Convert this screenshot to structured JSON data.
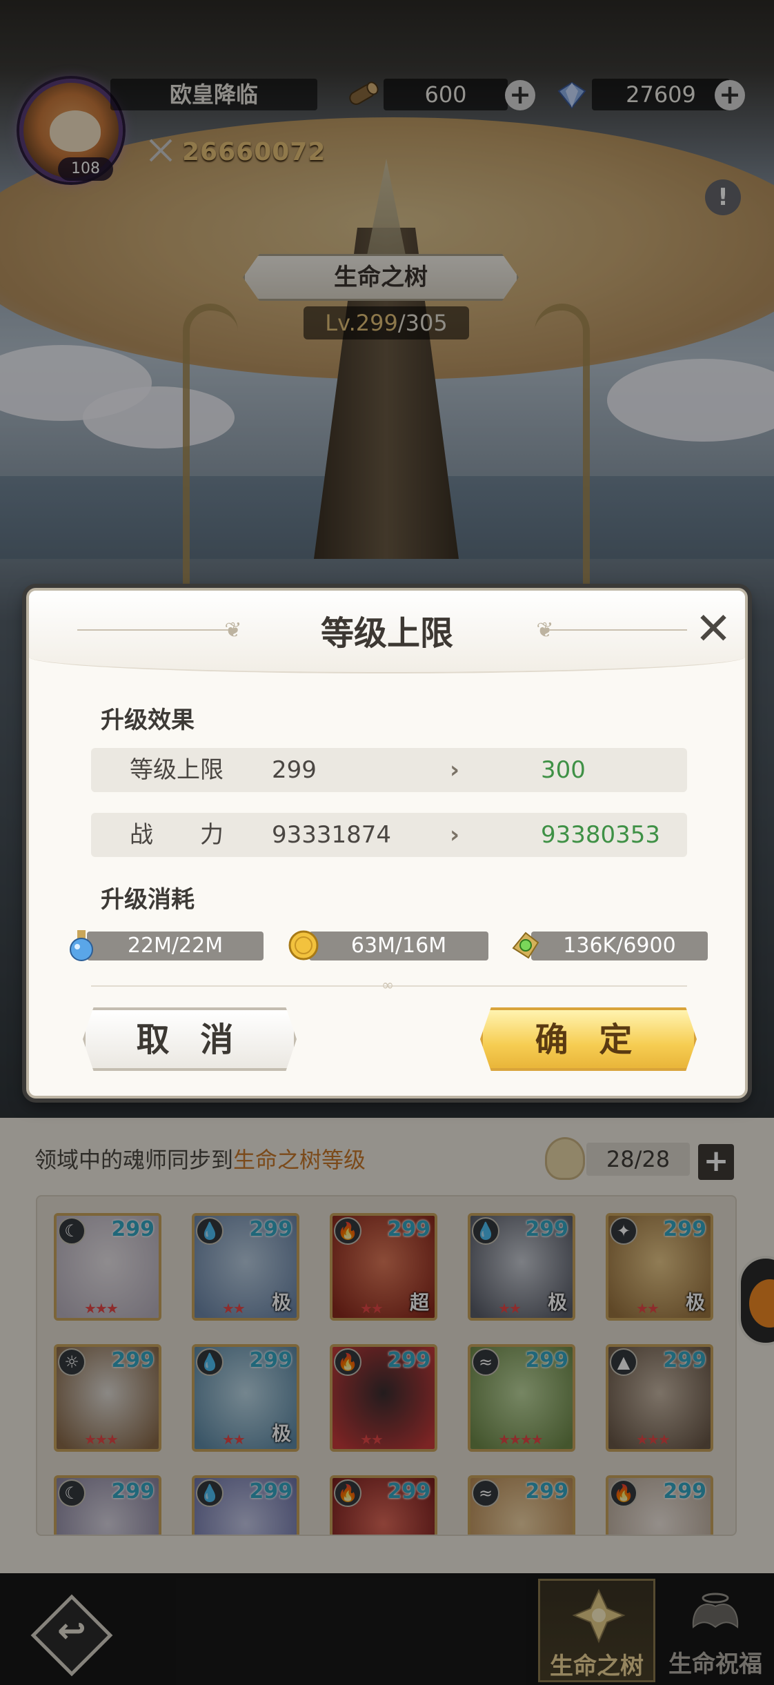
{
  "player": {
    "name": "欧皇降临",
    "level": "108",
    "combat_power": "26660072"
  },
  "resources": [
    {
      "icon": "wood-log-icon",
      "value": "600"
    },
    {
      "icon": "diamond-icon",
      "value": "27609"
    }
  ],
  "building": {
    "title": "生命之树",
    "level_current": "Lv.299",
    "level_max": "/305"
  },
  "dialog": {
    "title": "等级上限",
    "effect_label": "升级效果",
    "effects": [
      {
        "label": "等级上限",
        "from": "299",
        "to": "300"
      },
      {
        "label": "战　　力",
        "from": "93331874",
        "to": "93380353"
      }
    ],
    "cost_label": "升级消耗",
    "costs": [
      {
        "icon": "exp-potion-icon",
        "value": "22M/22M"
      },
      {
        "icon": "gold-coin-icon",
        "value": "63M/16M"
      },
      {
        "icon": "green-gem-icon",
        "value": "136K/6900"
      }
    ],
    "cancel_label": "取 消",
    "confirm_label": "确 定"
  },
  "panel": {
    "text_prefix": "领域中的魂师同步到",
    "text_highlight": "生命之树等级",
    "slot_count": "28/28",
    "plus_label": "+"
  },
  "heroes": [
    {
      "level": "299",
      "element": "moon",
      "stars": "★★★",
      "rank": ""
    },
    {
      "level": "299",
      "element": "water",
      "stars": "★★",
      "rank": "极"
    },
    {
      "level": "299",
      "element": "fire",
      "stars": "★★",
      "rank": "超"
    },
    {
      "level": "299",
      "element": "water",
      "stars": "★★",
      "rank": "极"
    },
    {
      "level": "299",
      "element": "light",
      "stars": "★★",
      "rank": "极"
    },
    {
      "level": "299",
      "element": "sun",
      "stars": "★★★",
      "rank": ""
    },
    {
      "level": "299",
      "element": "water",
      "stars": "★★",
      "rank": "极"
    },
    {
      "level": "299",
      "element": "fire",
      "stars": "★★",
      "rank": ""
    },
    {
      "level": "299",
      "element": "wind",
      "stars": "★★★★",
      "rank": ""
    },
    {
      "level": "299",
      "element": "earth",
      "stars": "★★★",
      "rank": ""
    },
    {
      "level": "299",
      "element": "moon",
      "stars": "",
      "rank": ""
    },
    {
      "level": "299",
      "element": "water",
      "stars": "",
      "rank": ""
    },
    {
      "level": "299",
      "element": "fire",
      "stars": "",
      "rank": ""
    },
    {
      "level": "299",
      "element": "wind",
      "stars": "",
      "rank": ""
    },
    {
      "level": "299",
      "element": "fire",
      "stars": "",
      "rank": ""
    }
  ],
  "bottom_nav": {
    "back_icon": "back-arrow-icon",
    "tabs": [
      {
        "label": "生命之树",
        "active": true
      },
      {
        "label": "生命祝福",
        "active": false
      }
    ]
  },
  "colors": {
    "accent_gold": "#f6cd52",
    "positive_green": "#3f9146",
    "level_cyan": "#35a6c4",
    "highlight_orange": "#c7782a"
  }
}
